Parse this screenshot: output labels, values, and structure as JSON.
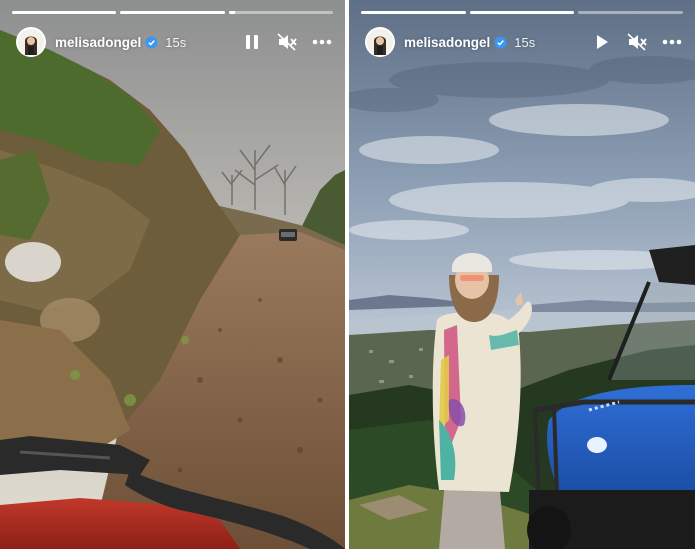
{
  "stories": [
    {
      "username": "melisadongel",
      "time": "15s",
      "progress": [
        1,
        1,
        0.06
      ],
      "playback_icon": "pause-icon",
      "sound_icon": "muted-icon",
      "more_icon": "more-icon"
    },
    {
      "username": "melisadongel",
      "time": "15s",
      "progress": [
        1,
        1,
        0
      ],
      "playback_icon": "play-icon",
      "sound_icon": "muted-icon",
      "more_icon": "more-icon"
    }
  ],
  "colors": {
    "verified_badge": "#3897f0",
    "progress_fill": "#ffffff",
    "progress_track": "rgba(255,255,255,0.45)"
  }
}
